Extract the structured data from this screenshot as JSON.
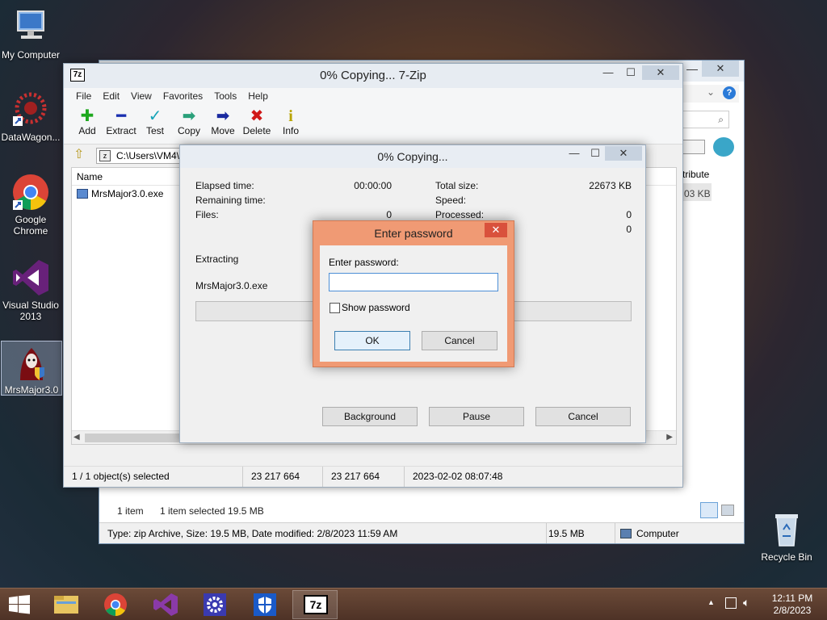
{
  "desktop": {
    "icons": [
      {
        "label": "My Computer"
      },
      {
        "label": "DataWagon..."
      },
      {
        "label": "Google Chrome"
      },
      {
        "label": "Visual Studio 2013"
      },
      {
        "label": "MrsMajor3.0"
      },
      {
        "label": "Recycle Bin"
      }
    ]
  },
  "explorer": {
    "close_glyph": "✕",
    "status": {
      "items_count": "1 item",
      "items_selected": "1 item selected  19.5 MB",
      "details": "Type: zip Archive, Size: 19.5 MB, Date modified: 2/8/2023 11:59 AM",
      "size": "19.5 MB",
      "location": "Computer"
    },
    "partial_col": "tribute",
    "partial_size": "03 KB"
  },
  "zip_window": {
    "title": "0% Copying... 7-Zip",
    "menu": [
      "File",
      "Edit",
      "View",
      "Favorites",
      "Tools",
      "Help"
    ],
    "toolbar": [
      {
        "label": "Add",
        "glyph": "✚",
        "color": "#1ea81e"
      },
      {
        "label": "Extract",
        "glyph": "━",
        "color": "#1a2fb0"
      },
      {
        "label": "Test",
        "glyph": "✓",
        "color": "#16a4b8"
      },
      {
        "label": "Copy",
        "glyph": "➡",
        "color": "#2aa07a"
      },
      {
        "label": "Move",
        "glyph": "➡",
        "color": "#1a2aa0"
      },
      {
        "label": "Delete",
        "glyph": "✖",
        "color": "#d01818"
      },
      {
        "label": "Info",
        "glyph": "i",
        "color": "#b8a400"
      }
    ],
    "address": "C:\\Users\\VM4\\",
    "columns": {
      "name": "Name"
    },
    "files": [
      {
        "name": "MrsMajor3.0.exe"
      }
    ],
    "status": {
      "selected": "1 / 1 object(s) selected",
      "size": "23 217 664",
      "packed": "23 217 664",
      "modified": "2023-02-02 08:07:48"
    }
  },
  "progress_dialog": {
    "title": "0% Copying...",
    "elapsed_label": "Elapsed time:",
    "elapsed_value": "00:00:00",
    "remaining_label": "Remaining time:",
    "files_label": "Files:",
    "files_value": "0",
    "total_size_label": "Total size:",
    "total_size_value": "22673 KB",
    "speed_label": "Speed:",
    "processed_label": "Processed:",
    "processed_value": "0",
    "extra_value": "0",
    "extracting_label": "Extracting",
    "current_file": "MrsMajor3.0.exe",
    "buttons": {
      "background": "Background",
      "pause": "Pause",
      "cancel": "Cancel"
    }
  },
  "password_dialog": {
    "title": "Enter password",
    "prompt": "Enter password:",
    "password_value": "",
    "show_password_label": "Show password",
    "ok": "OK",
    "cancel": "Cancel",
    "close_glyph": "✕"
  },
  "taskbar": {
    "time": "12:11 PM",
    "date": "2/8/2023",
    "zip_label": "7z"
  },
  "window_controls": {
    "minimize": "—",
    "maximize": "☐",
    "close": "✕"
  }
}
